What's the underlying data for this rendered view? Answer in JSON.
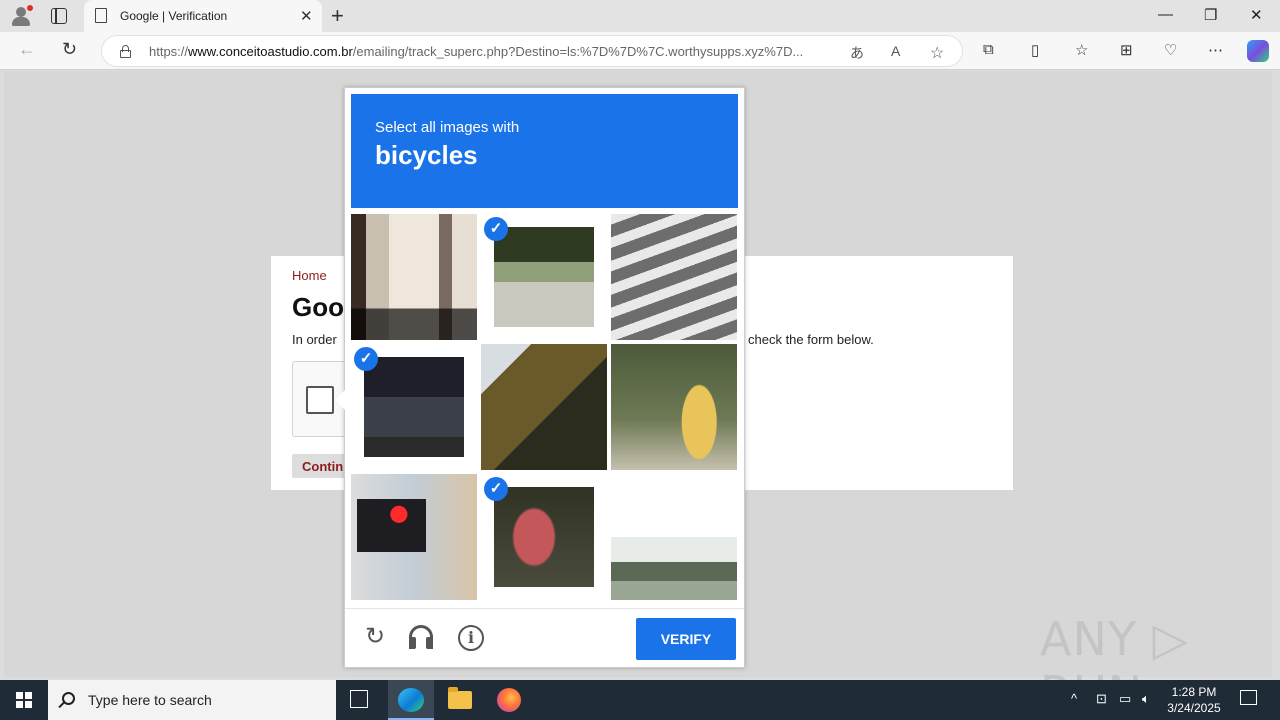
{
  "browser": {
    "tab_title": "Google | Verification",
    "url_prefix": "https://",
    "url_domain": "www.conceitoastudio.com.br",
    "url_path": "/emailing/track_superc.php?Destino=ls:%7D%7D%7C.worthysupps.xyz%7D...",
    "window_controls": {
      "minimize": "—",
      "restore": "❐",
      "close": "✕"
    },
    "new_tab": "+"
  },
  "page": {
    "home_link": "Home",
    "title": "Goo",
    "intro_left": "In order",
    "intro_right": "check the form below.",
    "continue_label": "Contin"
  },
  "captcha": {
    "prompt": "Select all images with",
    "target": "bicycles",
    "tiles": [
      {
        "scene": "building-stairs",
        "selected": false
      },
      {
        "scene": "cyclist-road",
        "selected": true
      },
      {
        "scene": "pedestrian-crosswalk",
        "selected": false
      },
      {
        "scene": "parked-bicycle",
        "selected": true
      },
      {
        "scene": "traffic-light-trees",
        "selected": false
      },
      {
        "scene": "fire-hydrant",
        "selected": false
      },
      {
        "scene": "red-traffic-light",
        "selected": false
      },
      {
        "scene": "red-bicycle",
        "selected": true
      },
      {
        "scene": "snowy-field",
        "selected": false
      }
    ],
    "verify_label": "VERIFY",
    "tick_glyph": "✓",
    "reload_glyph": "↻",
    "info_glyph": "i"
  },
  "watermark": "ANY ▷ RUN",
  "taskbar": {
    "search_placeholder": "Type here to search",
    "time": "1:28 PM",
    "date": "3/24/2025"
  },
  "colors": {
    "captcha_blue": "#1a73e8",
    "link_red": "#8b1d1d"
  }
}
